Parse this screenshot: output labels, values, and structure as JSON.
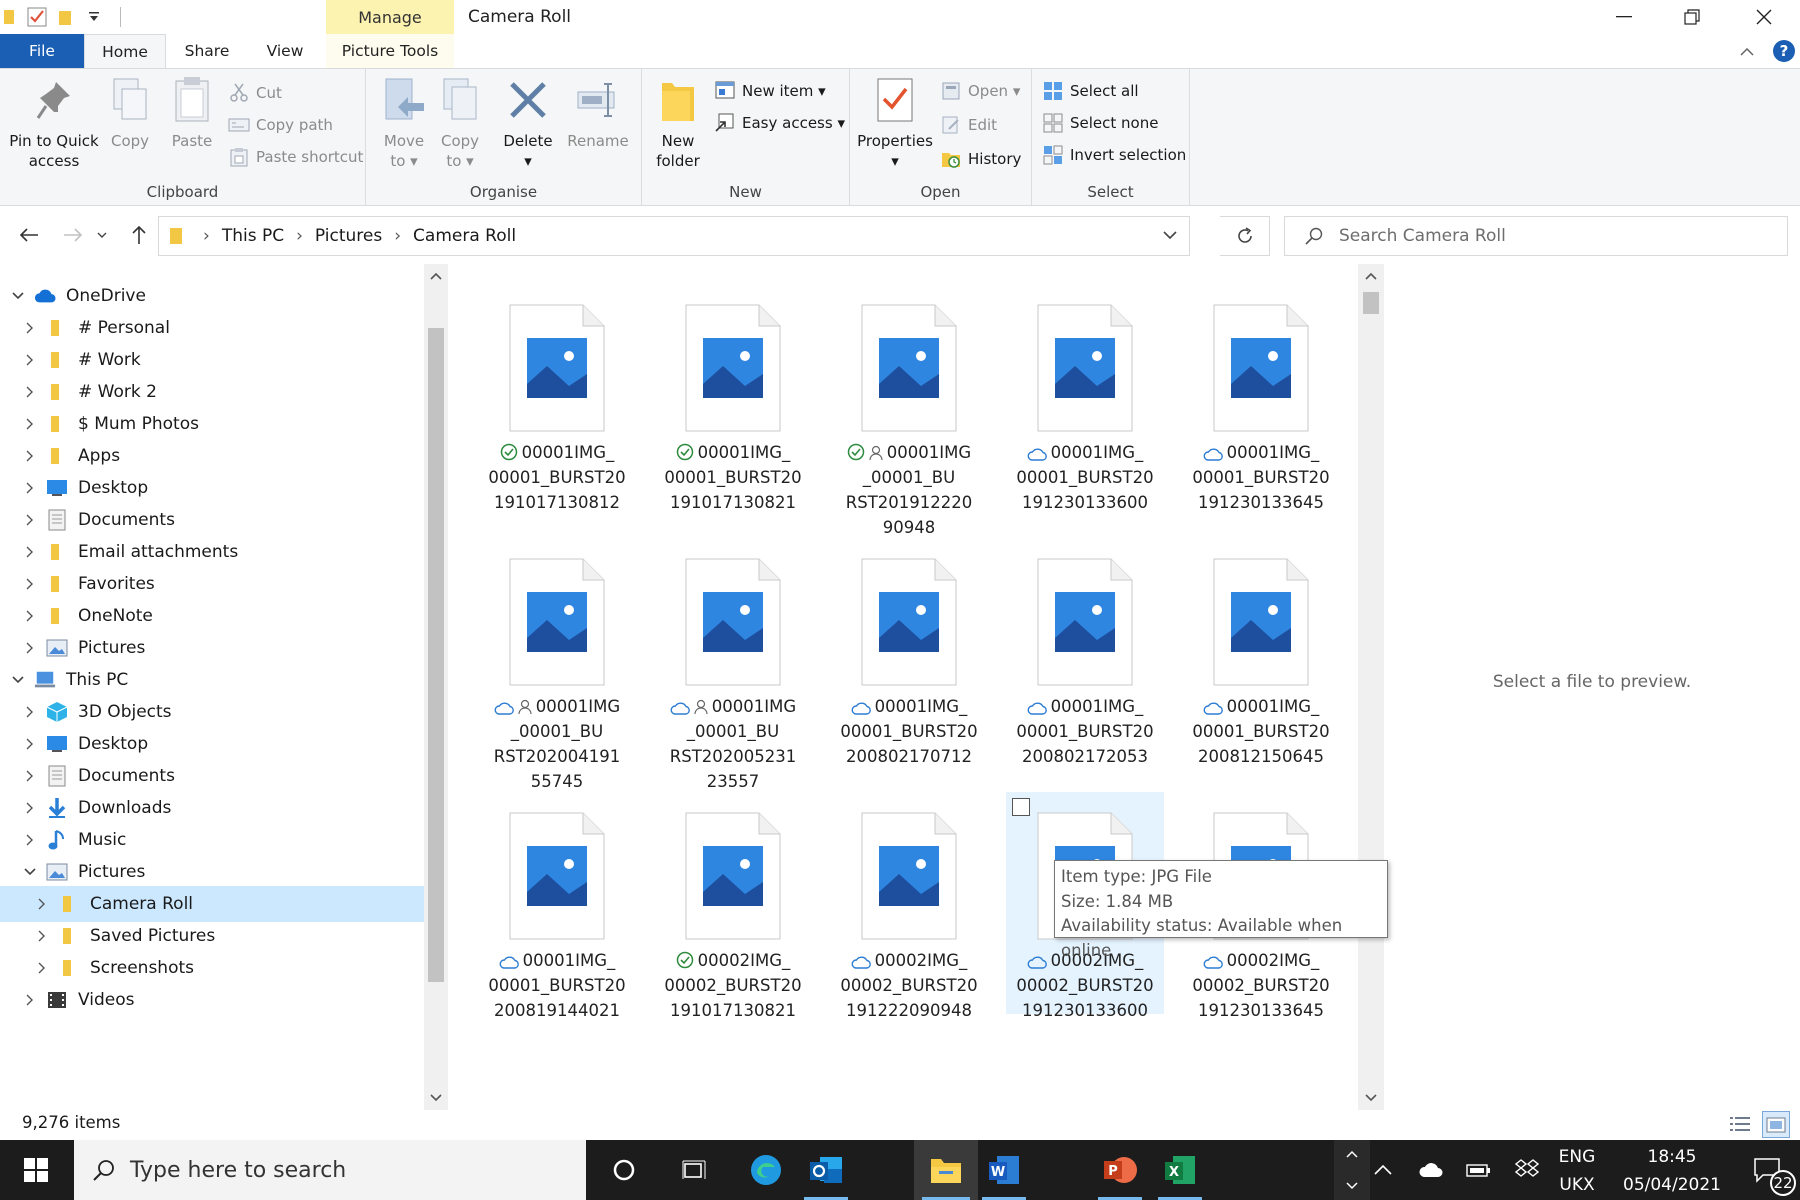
{
  "window": {
    "title": "Camera Roll",
    "context_tab": "Manage"
  },
  "tabs": {
    "file": "File",
    "home": "Home",
    "share": "Share",
    "view": "View",
    "picture_tools": "Picture Tools"
  },
  "ribbon": {
    "clipboard": {
      "label": "Clipboard",
      "pin_line1": "Pin to Quick",
      "pin_line2": "access",
      "copy": "Copy",
      "paste": "Paste",
      "cut": "Cut",
      "copy_path": "Copy path",
      "paste_shortcut": "Paste shortcut"
    },
    "organise": {
      "label": "Organise",
      "move_line1": "Move",
      "move_line2": "to",
      "copy_line1": "Copy",
      "copy_line2": "to",
      "delete": "Delete",
      "rename": "Rename"
    },
    "new": {
      "label": "New",
      "folder_line1": "New",
      "folder_line2": "folder",
      "new_item": "New item",
      "easy_access": "Easy access"
    },
    "open": {
      "label": "Open",
      "properties": "Properties",
      "open": "Open",
      "edit": "Edit",
      "history": "History"
    },
    "select": {
      "label": "Select",
      "select_all": "Select all",
      "select_none": "Select none",
      "invert": "Invert selection"
    }
  },
  "address": {
    "crumbs": [
      "This PC",
      "Pictures",
      "Camera Roll"
    ],
    "search_placeholder": "Search Camera Roll"
  },
  "sidebar": {
    "items": [
      {
        "label": "OneDrive"
      },
      {
        "label": "# Personal"
      },
      {
        "label": "# Work"
      },
      {
        "label": "# Work 2"
      },
      {
        "label": "$ Mum Photos"
      },
      {
        "label": "Apps"
      },
      {
        "label": "Desktop"
      },
      {
        "label": "Documents"
      },
      {
        "label": "Email attachments"
      },
      {
        "label": "Favorites"
      },
      {
        "label": "OneNote"
      },
      {
        "label": "Pictures"
      },
      {
        "label": "This PC"
      },
      {
        "label": "3D Objects"
      },
      {
        "label": "Desktop"
      },
      {
        "label": "Documents"
      },
      {
        "label": "Downloads"
      },
      {
        "label": "Music"
      },
      {
        "label": "Pictures"
      },
      {
        "label": "Camera Roll"
      },
      {
        "label": "Saved Pictures"
      },
      {
        "label": "Screenshots"
      },
      {
        "label": "Videos"
      }
    ]
  },
  "files": [
    {
      "name": "00001IMG_00001_BURST20191017130812",
      "status": "synced"
    },
    {
      "name": "00001IMG_00001_BURST20191017130821",
      "status": "synced"
    },
    {
      "name": "00001IMG_00001_BURST20191222090948",
      "status": "synced-shared"
    },
    {
      "name": "00001IMG_00001_BURST20191230133600",
      "status": "cloud"
    },
    {
      "name": "00001IMG_00001_BURST20191230133645",
      "status": "cloud"
    },
    {
      "name": "00001IMG_00001_BURST20200419155745",
      "status": "cloud-shared"
    },
    {
      "name": "00001IMG_00001_BURST20200523123557",
      "status": "cloud-shared"
    },
    {
      "name": "00001IMG_00001_BURST20200802170712",
      "status": "cloud"
    },
    {
      "name": "00001IMG_00001_BURST20200802172053",
      "status": "cloud"
    },
    {
      "name": "00001IMG_00001_BURST20200812150645",
      "status": "cloud"
    },
    {
      "name": "00001IMG_00001_BURST20200819144021",
      "status": "cloud"
    },
    {
      "name": "00002IMG_00002_BURST20191017130821",
      "status": "synced"
    },
    {
      "name": "00002IMG_00002_BURST20191222090948",
      "status": "cloud"
    },
    {
      "name": "00002IMG_00002_BURST20191230133600",
      "status": "cloud"
    },
    {
      "name": "00002IMG_00002_BURST20191230133645",
      "status": "cloud"
    }
  ],
  "preview_text": "Select a file to preview.",
  "tooltip": {
    "line1": "Item type: JPG File",
    "line2": "Size: 1.84 MB",
    "line3": "Availability status: Available when online"
  },
  "status": {
    "item_count": "9,276 items"
  },
  "taskbar": {
    "search_placeholder": "Type here to search",
    "lang1": "ENG",
    "lang2": "UKX",
    "time": "18:45",
    "date": "05/04/2021",
    "notifications": "22"
  },
  "colors": {
    "file_tab": "#1a5fb4",
    "manage_tab": "#fcf3b1",
    "selection": "#cce8ff",
    "hover": "#e5f3ff",
    "taskbar": "#1c1c1c"
  }
}
